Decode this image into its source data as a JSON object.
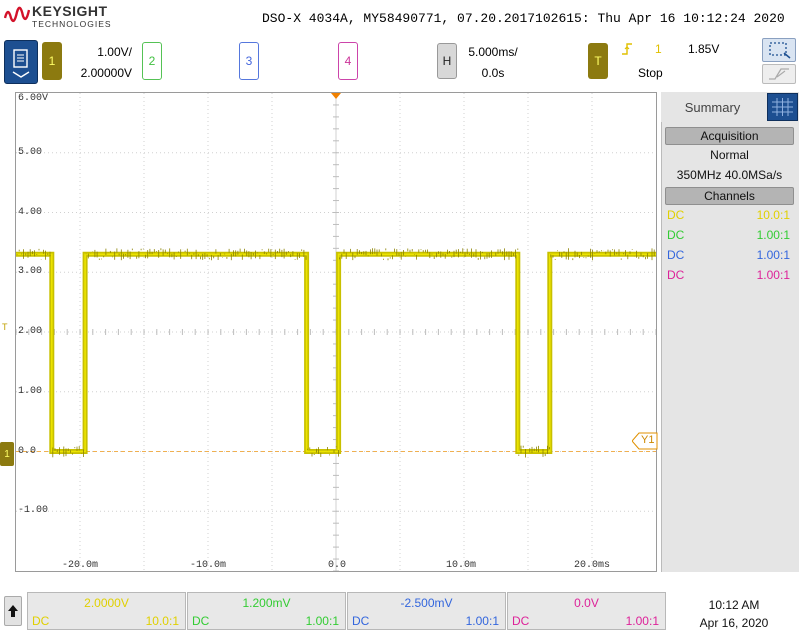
{
  "brand": {
    "name": "KEYSIGHT",
    "sub": "TECHNOLOGIES"
  },
  "header": {
    "title": "DSO-X 4034A, MY58490771, 07.20.2017102615: Thu Apr 16 10:12:24 2020"
  },
  "channels_bar": {
    "ch1": {
      "label": "1",
      "scale": "1.00V/",
      "offset": "2.00000V"
    },
    "ch2": {
      "label": "2"
    },
    "ch3": {
      "label": "3"
    },
    "ch4": {
      "label": "4"
    }
  },
  "horizontal": {
    "label": "H",
    "scale": "5.000ms/",
    "delay": "0.0s"
  },
  "trigger": {
    "label": "T",
    "edge_icon": "rising-edge-icon",
    "source": "1",
    "level": "1.85V",
    "state": "Stop"
  },
  "graticule": {
    "y_labels": [
      "6.00V",
      "5.00",
      "4.00",
      "3.00",
      "2.00",
      "1.00",
      "0.0",
      "-1.00"
    ],
    "x_labels": [
      "-20.0m",
      "-10.0m",
      "0.0",
      "10.0m",
      "20.0ms"
    ],
    "ground_marker": "1",
    "trigger_level_marker": "T",
    "cursor_label": "Y1"
  },
  "summary": {
    "tab_label": "Summary",
    "acquisition_header": "Acquisition",
    "acquisition_mode": "Normal",
    "acquisition_rate": "350MHz  40.0MSa/s",
    "channels_header": "Channels",
    "channels": [
      {
        "coupling": "DC",
        "probe": "10.0:1",
        "color": "#e0d000"
      },
      {
        "coupling": "DC",
        "probe": "1.00:1",
        "color": "#33cc33"
      },
      {
        "coupling": "DC",
        "probe": "1.00:1",
        "color": "#3366dd"
      },
      {
        "coupling": "DC",
        "probe": "1.00:1",
        "color": "#dd2299"
      }
    ]
  },
  "status_bar": [
    {
      "offset": "2.0000V",
      "coupling": "DC",
      "probe": "10.0:1",
      "color": "#e0d000"
    },
    {
      "offset": "1.200mV",
      "coupling": "DC",
      "probe": "1.00:1",
      "color": "#33cc33"
    },
    {
      "offset": "-2.500mV",
      "coupling": "DC",
      "probe": "1.00:1",
      "color": "#3366dd"
    },
    {
      "offset": "0.0V",
      "coupling": "DC",
      "probe": "1.00:1",
      "color": "#dd2299"
    }
  ],
  "clock": {
    "time": "10:12 AM",
    "date": "Apr 16, 2020"
  },
  "colors": {
    "ch1": "#e0d000",
    "ch1_dark": "#8c7a10",
    "ch2": "#33cc33",
    "ch3": "#3366dd",
    "ch4": "#dd2299",
    "accent": "#1d4f91"
  },
  "chart_data": {
    "type": "line",
    "title": "",
    "xlabel": "",
    "ylabel": "",
    "xlim": [
      -25,
      25
    ],
    "ylim": [
      -2.0,
      6.0
    ],
    "x_unit": "ms",
    "y_unit": "V",
    "grid": true,
    "series": [
      {
        "x": [
          -25.0,
          -22.2,
          -22.2,
          -19.6,
          -19.6,
          -2.3,
          -2.3,
          0.2,
          0.2,
          14.2,
          14.2,
          16.7,
          16.7,
          25.0
        ],
        "y": [
          3.3,
          3.3,
          0.0,
          0.0,
          3.3,
          3.3,
          0.0,
          0.0,
          3.3,
          3.3,
          0.0,
          0.0,
          3.3,
          3.3
        ]
      }
    ]
  }
}
